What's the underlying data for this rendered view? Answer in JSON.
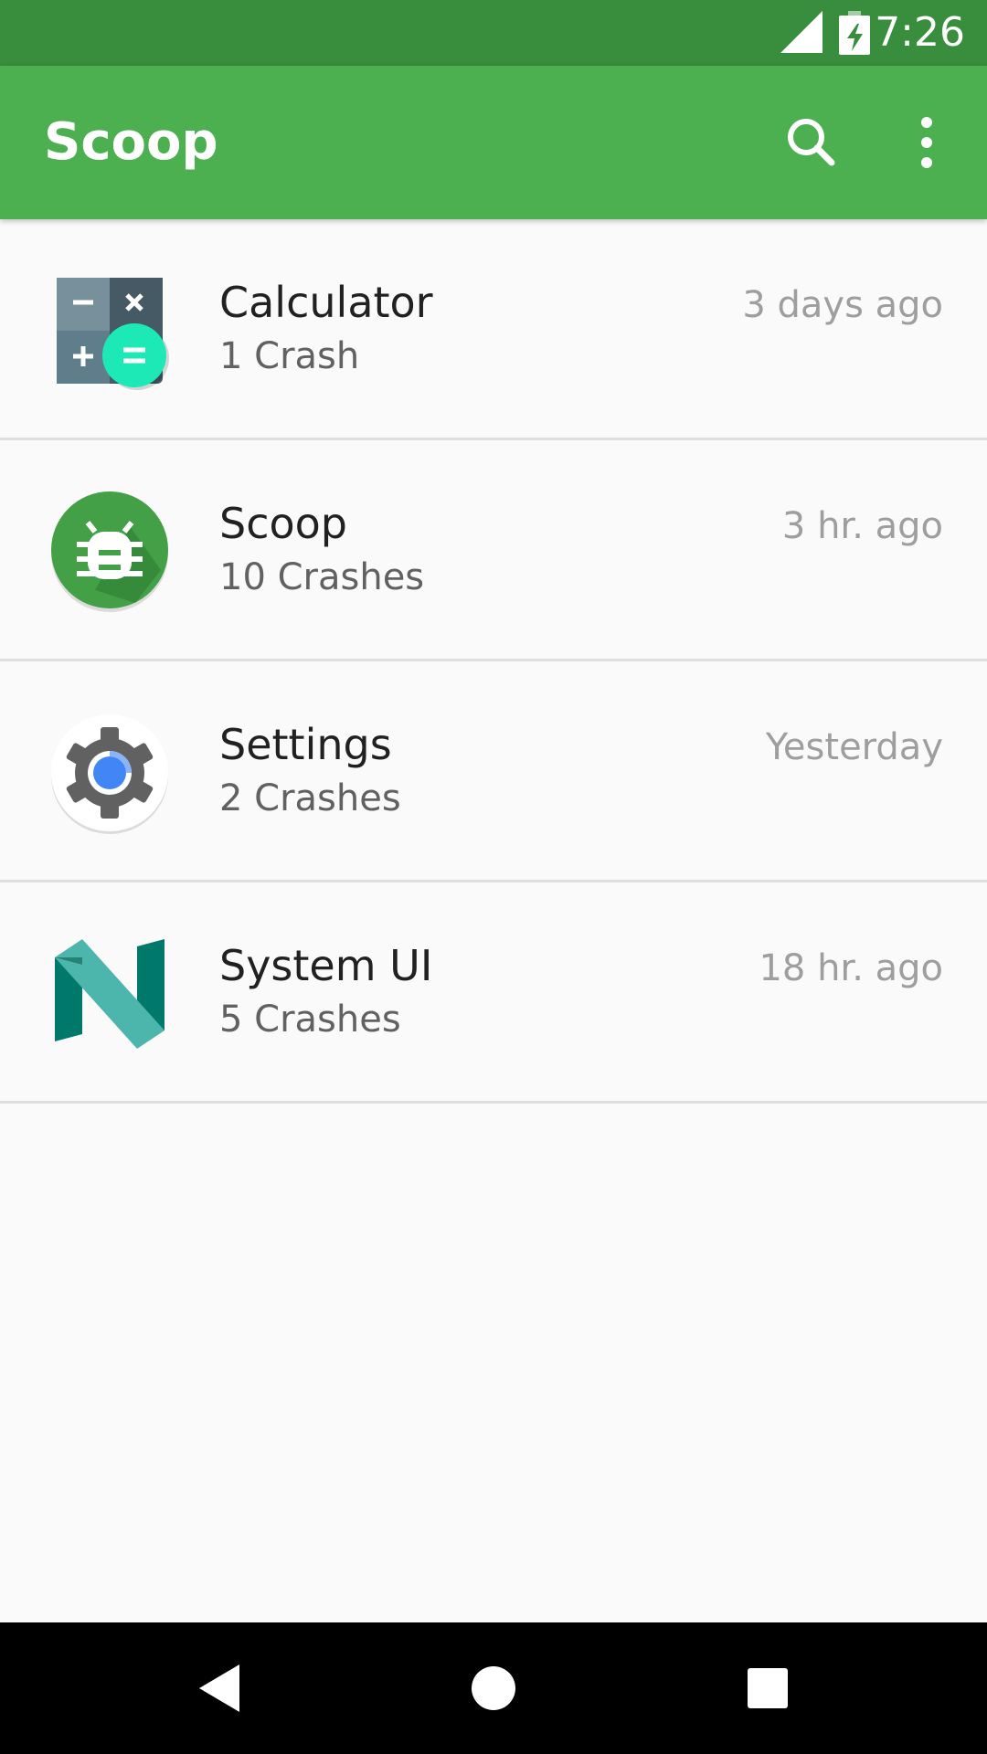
{
  "status_bar": {
    "time": "7:26",
    "icons": [
      "signal-icon",
      "battery-charging-icon"
    ]
  },
  "app_bar": {
    "title": "Scoop",
    "actions": [
      "search-icon",
      "more-vert-icon"
    ]
  },
  "crash_list": [
    {
      "app": "Calculator",
      "crashes": "1 Crash",
      "time": "3 days ago",
      "icon": "calculator-app-icon"
    },
    {
      "app": "Scoop",
      "crashes": "10 Crashes",
      "time": "3 hr. ago",
      "icon": "scoop-bug-app-icon"
    },
    {
      "app": "Settings",
      "crashes": "2 Crashes",
      "time": "Yesterday",
      "icon": "settings-gear-app-icon"
    },
    {
      "app": "System UI",
      "crashes": "5 Crashes",
      "time": "18 hr. ago",
      "icon": "system-ui-n-app-icon"
    }
  ],
  "nav_bar": {
    "buttons": [
      "back-icon",
      "home-icon",
      "recents-icon"
    ]
  },
  "colors": {
    "status_bar": "#388e3c",
    "app_bar": "#4caf50",
    "background": "#fafafa",
    "primary_text": "#212121",
    "secondary_text": "#616161",
    "tertiary_text": "#9e9e9e"
  }
}
